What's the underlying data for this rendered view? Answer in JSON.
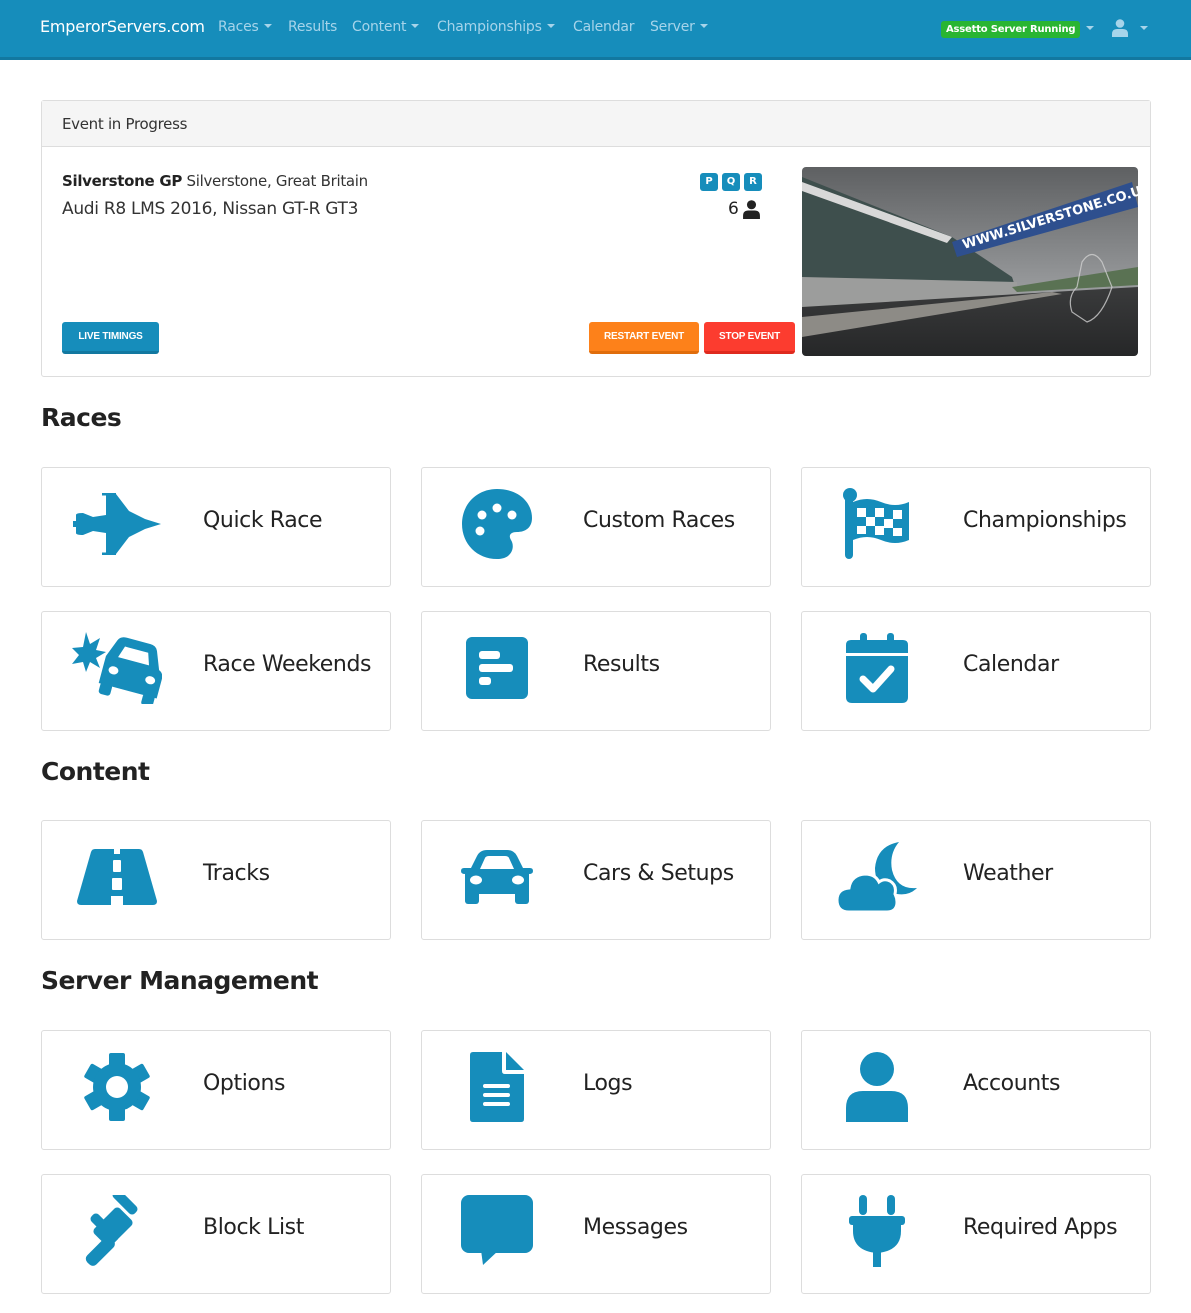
{
  "navbar": {
    "brand": "EmperorServers.com",
    "items": [
      {
        "label": "Races",
        "dropdown": true
      },
      {
        "label": "Results",
        "dropdown": false
      },
      {
        "label": "Content",
        "dropdown": true
      },
      {
        "label": "Championships",
        "dropdown": true
      },
      {
        "label": "Calendar",
        "dropdown": false
      },
      {
        "label": "Server",
        "dropdown": true
      }
    ],
    "server_status": "Assetto Server Running",
    "user_icon": "user-icon"
  },
  "event": {
    "header": "Event in Progress",
    "track_name": "Silverstone GP",
    "track_location": "Silverstone, Great Britain",
    "cars": "Audi R8 LMS 2016, Nissan GT-R GT3",
    "sessions": [
      "P",
      "Q",
      "R"
    ],
    "driver_count": "6",
    "buttons": {
      "live_timings": "LIVE TIMINGS",
      "restart": "RESTART EVENT",
      "stop": "STOP EVENT"
    },
    "image_sign_text": "WWW.SILVERSTONE.CO.UK"
  },
  "sections": [
    {
      "title": "Races",
      "tiles": [
        {
          "label": "Quick Race",
          "icon": "fighter-jet-icon"
        },
        {
          "label": "Custom Races",
          "icon": "palette-icon"
        },
        {
          "label": "Championships",
          "icon": "checkered-flag-icon"
        },
        {
          "label": "Race Weekends",
          "icon": "car-crash-icon"
        },
        {
          "label": "Results",
          "icon": "poll-h-icon"
        },
        {
          "label": "Calendar",
          "icon": "calendar-check-icon"
        }
      ]
    },
    {
      "title": "Content",
      "tiles": [
        {
          "label": "Tracks",
          "icon": "road-icon"
        },
        {
          "label": "Cars & Setups",
          "icon": "car-icon"
        },
        {
          "label": "Weather",
          "icon": "cloud-moon-icon"
        }
      ]
    },
    {
      "title": "Server Management",
      "tiles": [
        {
          "label": "Options",
          "icon": "cog-icon"
        },
        {
          "label": "Logs",
          "icon": "file-alt-icon"
        },
        {
          "label": "Accounts",
          "icon": "user-icon"
        },
        {
          "label": "Block List",
          "icon": "gavel-icon"
        },
        {
          "label": "Messages",
          "icon": "comment-icon"
        },
        {
          "label": "Required Apps",
          "icon": "plug-icon"
        }
      ]
    }
  ],
  "colors": {
    "primary": "#168dbb",
    "success": "#29b532",
    "warning": "#fd811a",
    "danger": "#fc3c2f"
  }
}
